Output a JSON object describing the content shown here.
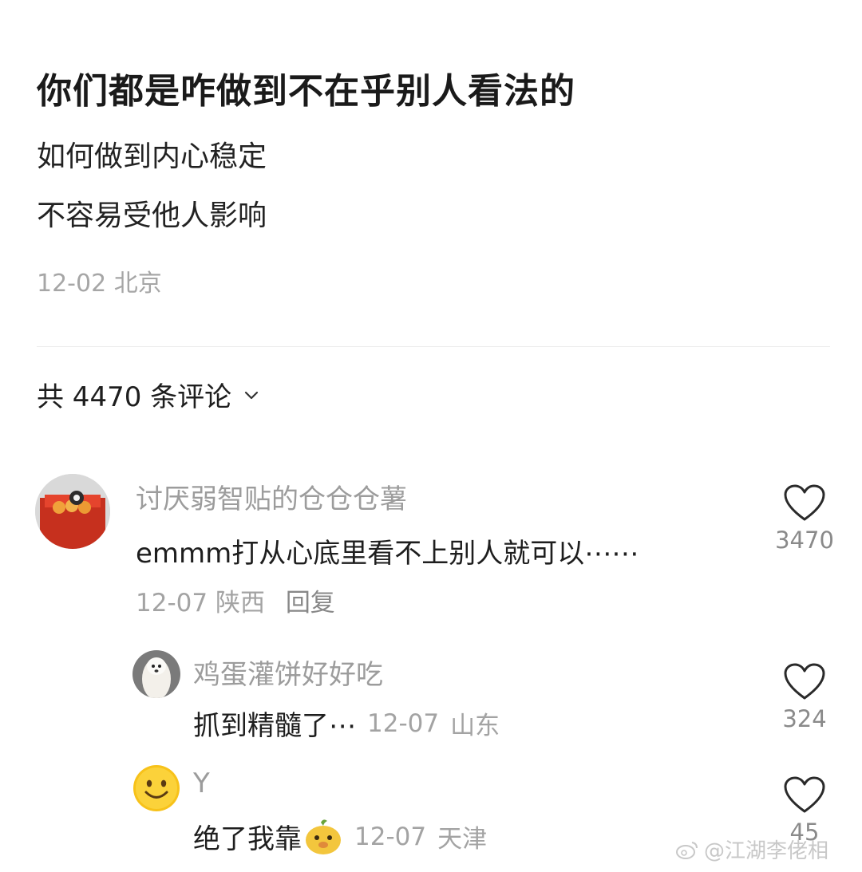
{
  "post": {
    "title": "你们都是咋做到不在乎别人看法的",
    "body_lines": [
      "如何做到内心稳定",
      "不容易受他人影响"
    ],
    "date": "12-02",
    "location": "北京"
  },
  "comments_header": {
    "label": "共 4470 条评论"
  },
  "comments": [
    {
      "username": "讨厌弱智贴的仓仓仓薯",
      "text": "emmm打从心底里看不上别人就可以⋯⋯",
      "date": "12-07",
      "location": "陕西",
      "reply_label": "回复",
      "likes": "3470",
      "replies": [
        {
          "username": "鸡蛋灌饼好好吃",
          "text": "抓到精髓了⋯",
          "date": "12-07",
          "location": "山东",
          "likes": "324"
        },
        {
          "username": "Y",
          "text": "绝了我靠",
          "date": "12-07",
          "location": "天津",
          "likes": "45"
        }
      ]
    }
  ],
  "watermark": {
    "text": "@江湖李佬相"
  },
  "colors": {
    "heart_stroke": "#2a2a2a",
    "meta": "#a3a3a3",
    "username": "#9c9c9c"
  }
}
